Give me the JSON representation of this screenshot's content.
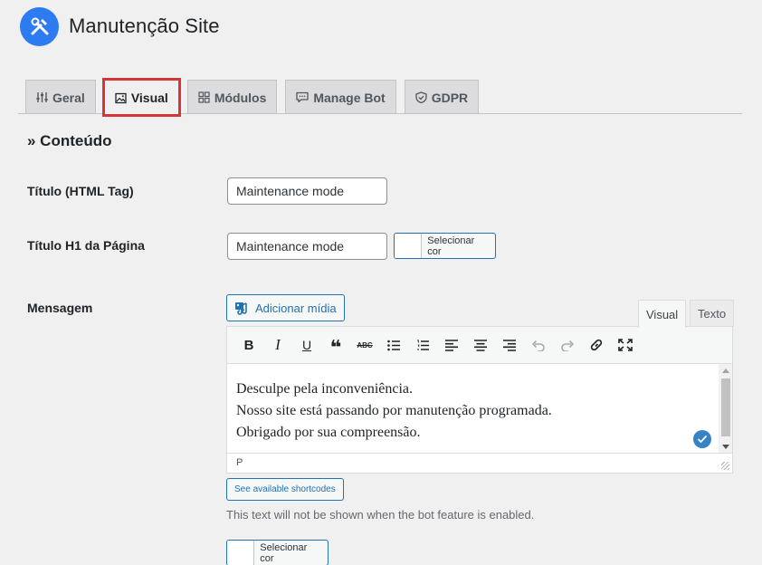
{
  "header": {
    "title": "Manutenção Site",
    "logo_icon": "tools-icon"
  },
  "tabs": [
    {
      "label": "Geral",
      "icon": "sliders-icon",
      "active": false
    },
    {
      "label": "Visual",
      "icon": "image-icon",
      "active": true
    },
    {
      "label": "Módulos",
      "icon": "grid-icon",
      "active": false
    },
    {
      "label": "Manage Bot",
      "icon": "chat-icon",
      "active": false
    },
    {
      "label": "GDPR",
      "icon": "shield-icon",
      "active": false
    }
  ],
  "section": {
    "title": "» Conteúdo"
  },
  "fields": {
    "title_tag": {
      "label": "Título (HTML Tag)",
      "value": "Maintenance mode"
    },
    "h1_title": {
      "label": "Título H1 da Página",
      "value": "Maintenance mode",
      "color_button": "Selecionar cor"
    },
    "message": {
      "label": "Mensagem",
      "add_media": "Adicionar mídia",
      "editor_tabs": {
        "visual": "Visual",
        "text": "Texto"
      },
      "lines": [
        "Desculpe pela inconveniência.",
        "Nosso site está passando por manutenção programada.",
        "Obrigado por sua compreensão."
      ],
      "path": "P",
      "shortcodes_button": "See available shortcodes",
      "help": "This text will not be shown when the bot feature is enabled.",
      "color_button": "Selecionar cor"
    }
  },
  "toolbar": {
    "bold": "B",
    "italic": "I",
    "underline": "U",
    "quote": "❝",
    "strikethrough": "ABC"
  },
  "colors": {
    "accent": "#2271b1",
    "highlight": "#d63638",
    "logo": "#2c7bf0"
  }
}
